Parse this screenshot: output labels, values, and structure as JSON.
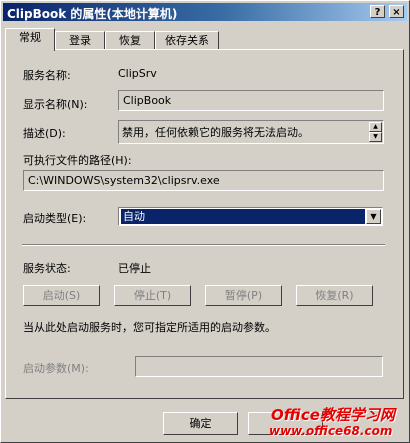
{
  "window": {
    "title": "ClipBook 的属性(本地计算机)",
    "help_button": "?",
    "close_button": "×"
  },
  "tabs": [
    {
      "label": "常规",
      "active": true
    },
    {
      "label": "登录",
      "active": false
    },
    {
      "label": "恢复",
      "active": false
    },
    {
      "label": "依存关系",
      "active": false
    }
  ],
  "general": {
    "service_name_label": "服务名称:",
    "service_name_value": "ClipSrv",
    "display_name_label": "显示名称(N):",
    "display_name_value": "ClipBook",
    "description_label": "描述(D):",
    "description_value": "禁用，任何依赖它的服务将无法启动。",
    "exe_path_label": "可执行文件的路径(H):",
    "exe_path_value": "C:\\WINDOWS\\system32\\clipsrv.exe",
    "startup_type_label": "启动类型(E):",
    "startup_type_value": "自动",
    "status_label": "服务状态:",
    "status_value": "已停止",
    "buttons": {
      "start": "启动(S)",
      "stop": "停止(T)",
      "pause": "暂停(P)",
      "resume": "恢复(R)"
    },
    "hint": "当从此处启动服务时，您可指定所适用的启动参数。",
    "start_params_label": "启动参数(M):",
    "start_params_value": ""
  },
  "dialog_buttons": {
    "ok": "确定"
  },
  "watermark": {
    "brand": "Office教程学习网",
    "url": "www.office68.com"
  },
  "colors": {
    "face": "#d4d0c8",
    "title_start": "#0a246a",
    "title_end": "#a6caf0",
    "selection": "#0a246a",
    "watermark": "#e60000"
  }
}
